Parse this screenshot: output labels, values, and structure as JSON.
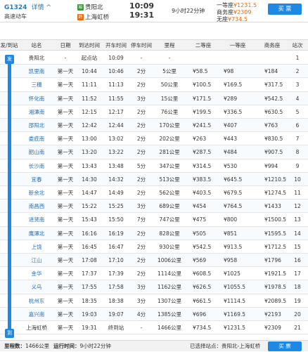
{
  "header": {
    "train_no": "G1324",
    "detail_label": "详情",
    "detail_arrow": "^",
    "train_type": "高速动车",
    "from_badge": "始",
    "from_station": "贵阳北",
    "to_badge": "终",
    "to_station": "上海虹桥",
    "dep_time": "10:09",
    "arr_time": "19:31",
    "duration": "9小时22分钟",
    "prices": [
      {
        "label": "一等座",
        "value": "¥1231.5"
      },
      {
        "label": "商务座",
        "value": "¥2309"
      },
      {
        "label": "无座",
        "value": "¥734.5"
      }
    ],
    "buy_label": "买 票"
  },
  "table": {
    "headers": {
      "route": "发/到站",
      "station": "站名",
      "date": "日期",
      "arr": "到达时间",
      "dep": "开车时间",
      "stop": "停车时间",
      "dist": "里程",
      "p2": "二等座",
      "p1": "一等座",
      "pb": "商务座",
      "no": "站次"
    },
    "route_start": "发",
    "route_end": "到",
    "rows": [
      {
        "station": "贵阳北",
        "date": "-",
        "arr": "起点站",
        "dep": "10:09",
        "stop": "-",
        "dist": "-",
        "p2": "",
        "p1": "",
        "pb": "",
        "no": "1"
      },
      {
        "station": "凯里南",
        "date": "第一天",
        "arr": "10:44",
        "dep": "10:46",
        "stop": "2分",
        "dist": "5公里",
        "p2": "¥58.5",
        "p1": "¥98",
        "pb": "¥184",
        "no": "2"
      },
      {
        "station": "三穗",
        "date": "第一天",
        "arr": "11:11",
        "dep": "11:13",
        "stop": "2分",
        "dist": "50公里",
        "p2": "¥100.5",
        "p1": "¥169.5",
        "pb": "¥317.5",
        "no": "3"
      },
      {
        "station": "怀化南",
        "date": "第一天",
        "arr": "11:52",
        "dep": "11:55",
        "stop": "3分",
        "dist": "15公里",
        "p2": "¥171.5",
        "p1": "¥289",
        "pb": "¥542.5",
        "no": "4"
      },
      {
        "station": "湘潭南",
        "date": "第一天",
        "arr": "12:15",
        "dep": "12:17",
        "stop": "2分",
        "dist": "76公里",
        "p2": "¥199.5",
        "p1": "¥336.5",
        "pb": "¥630.5",
        "no": "5"
      },
      {
        "station": "邵阳北",
        "date": "第一天",
        "arr": "12:42",
        "dep": "12:44",
        "stop": "2分",
        "dist": "170公里",
        "p2": "¥241.5",
        "p1": "¥407",
        "pb": "¥763",
        "no": "6"
      },
      {
        "station": "娄底南",
        "date": "第一天",
        "arr": "13:00",
        "dep": "13:02",
        "stop": "2分",
        "dist": "202公里",
        "p2": "¥263",
        "p1": "¥443",
        "pb": "¥830.5",
        "no": "7"
      },
      {
        "station": "韶山南",
        "date": "第一天",
        "arr": "13:20",
        "dep": "13:22",
        "stop": "2分",
        "dist": "281公里",
        "p2": "¥287.5",
        "p1": "¥484",
        "pb": "¥907.5",
        "no": "8"
      },
      {
        "station": "长沙南",
        "date": "第一天",
        "arr": "13:43",
        "dep": "13:48",
        "stop": "5分",
        "dist": "347公里",
        "p2": "¥314.5",
        "p1": "¥530",
        "pb": "¥994",
        "no": "9"
      },
      {
        "station": "宜春",
        "date": "第一天",
        "arr": "14:30",
        "dep": "14:32",
        "stop": "2分",
        "dist": "513公里",
        "p2": "¥383.5",
        "p1": "¥645.5",
        "pb": "¥1210.5",
        "no": "10"
      },
      {
        "station": "新余北",
        "date": "第一天",
        "arr": "14:47",
        "dep": "14:49",
        "stop": "2分",
        "dist": "562公里",
        "p2": "¥403.5",
        "p1": "¥679.5",
        "pb": "¥1274.5",
        "no": "11"
      },
      {
        "station": "南昌西",
        "date": "第一天",
        "arr": "15:22",
        "dep": "15:25",
        "stop": "3分",
        "dist": "689公里",
        "p2": "¥454",
        "p1": "¥764.5",
        "pb": "¥1433",
        "no": "12"
      },
      {
        "station": "进贤南",
        "date": "第一天",
        "arr": "15:43",
        "dep": "15:50",
        "stop": "7分",
        "dist": "747公里",
        "p2": "¥475",
        "p1": "¥800",
        "pb": "¥1500.5",
        "no": "13"
      },
      {
        "station": "鹰潭北",
        "date": "第一天",
        "arr": "16:16",
        "dep": "16:19",
        "stop": "2分",
        "dist": "828公里",
        "p2": "¥505",
        "p1": "¥851",
        "pb": "¥1595.5",
        "no": "14"
      },
      {
        "station": "上饶",
        "date": "第一天",
        "arr": "16:45",
        "dep": "16:47",
        "stop": "2分",
        "dist": "930公里",
        "p2": "¥542.5",
        "p1": "¥913.5",
        "pb": "¥1712.5",
        "no": "15"
      },
      {
        "station": "江山",
        "date": "第一天",
        "arr": "17:08",
        "dep": "17:10",
        "stop": "2分",
        "dist": "1006公里",
        "p2": "¥569",
        "p1": "¥958",
        "pb": "¥1796",
        "no": "16"
      },
      {
        "station": "金华",
        "date": "第一天",
        "arr": "17:37",
        "dep": "17:39",
        "stop": "2分",
        "dist": "1114公里",
        "p2": "¥608.5",
        "p1": "¥1025",
        "pb": "¥1921.5",
        "no": "17"
      },
      {
        "station": "义乌",
        "date": "第一天",
        "arr": "17:55",
        "dep": "17:58",
        "stop": "3分",
        "dist": "1162公里",
        "p2": "¥626.5",
        "p1": "¥1055.5",
        "pb": "¥1978.5",
        "no": "18"
      },
      {
        "station": "杭州东",
        "date": "第一天",
        "arr": "18:35",
        "dep": "18:38",
        "stop": "3分",
        "dist": "1307公里",
        "p2": "¥661.5",
        "p1": "¥1114.5",
        "pb": "¥2089.5",
        "no": "19"
      },
      {
        "station": "嘉兴南",
        "date": "第一天",
        "arr": "19:03",
        "dep": "19:07",
        "stop": "4分",
        "dist": "1385公里",
        "p2": "¥696",
        "p1": "¥1169.5",
        "pb": "¥2193",
        "no": "20"
      },
      {
        "station": "上海虹桥",
        "date": "第一天",
        "arr": "19:31",
        "dep": "终到站",
        "stop": "-",
        "dist": "1466公里",
        "p2": "¥734.5",
        "p1": "¥1231.5",
        "pb": "¥2309",
        "no": "21"
      }
    ]
  },
  "footer": {
    "dist_label": "里程数：",
    "dist_value": "1466公里",
    "time_label": "运行时间：",
    "time_value": "9小时22分钟",
    "selected_label": "已选择站点：",
    "selected_value": "贵阳北-上海虹桥",
    "buy_label": "买 票"
  }
}
